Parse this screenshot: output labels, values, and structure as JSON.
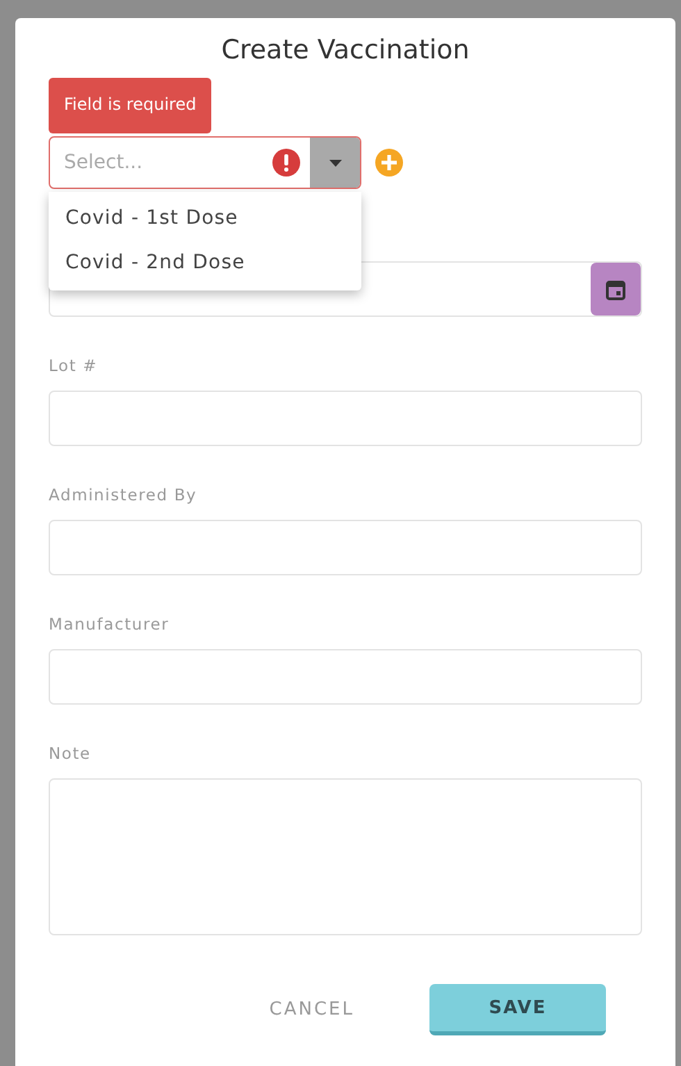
{
  "dialog": {
    "title": "Create Vaccination",
    "vaccine_select": {
      "placeholder": "Select...",
      "error": "Field is required",
      "invalid": true,
      "expanded": true,
      "options": [
        {
          "label": "Covid - 1st Dose",
          "selected": false
        },
        {
          "label": "Covid - 2nd Dose",
          "selected": false
        }
      ]
    },
    "fields": [
      {
        "label": "Lot #",
        "kind": "text"
      },
      {
        "label": "Administered By",
        "kind": "text"
      },
      {
        "label": "Manufacturer",
        "kind": "text"
      },
      {
        "label": "Note",
        "kind": "textarea"
      }
    ],
    "buttons": [
      {
        "label": "CANCEL",
        "kind": "flat"
      },
      {
        "label": "SAVE",
        "kind": "primary"
      }
    ]
  }
}
